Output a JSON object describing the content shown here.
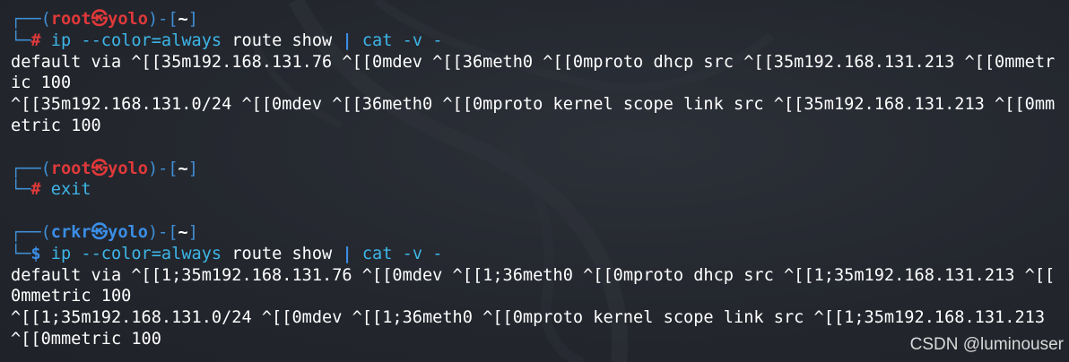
{
  "terminal": {
    "prompt_frame_top": "┌──(",
    "prompt_frame_mid": ")-[",
    "prompt_frame_end": "]",
    "prompt_frame_bottom": "└─",
    "sessions": [
      {
        "user": "root",
        "at": "㉿",
        "host": "yolo",
        "path": "~",
        "symbol": "#",
        "command": "ip",
        "args": " --color=always ",
        "subcmd": "route show",
        "pipe": " | ",
        "cmd2": "cat",
        "cmd2_args": " -v -",
        "output": [
          "default via ^[[35m192.168.131.76 ^[[0mdev ^[[36meth0 ^[[0mproto dhcp src ^[[35m192.168.131.213 ^[[0mmetr",
          "ic 100",
          "^[[35m192.168.131.0/24 ^[[0mdev ^[[36meth0 ^[[0mproto kernel scope link src ^[[35m192.168.131.213 ^[[0mm",
          "etric 100"
        ]
      },
      {
        "user": "root",
        "at": "㉿",
        "host": "yolo",
        "path": "~",
        "symbol": "#",
        "command": "exit"
      },
      {
        "user": "crkr",
        "at": "㉿",
        "host": "yolo",
        "path": "~",
        "symbol": "$",
        "command": "ip",
        "args": " --color=always ",
        "subcmd": "route show",
        "pipe": " | ",
        "cmd2": "cat",
        "cmd2_args": " -v -",
        "output": [
          "default via ^[[1;35m192.168.131.76 ^[[0mdev ^[[1;36meth0 ^[[0mproto dhcp src ^[[1;35m192.168.131.213 ^[[",
          "0mmetric 100",
          "^[[1;35m192.168.131.0/24 ^[[0mdev ^[[1;36meth0 ^[[0mproto kernel scope link src ^[[1;35m192.168.131.213",
          "^[[0mmetric 100"
        ]
      }
    ]
  },
  "watermark": "CSDN @luminouser",
  "colors": {
    "background": "#24282f",
    "frame_blue": "#3f8fd6",
    "root_red": "#e0393a",
    "user_blue": "#3b8ee6",
    "command_cyan": "#3db6e8"
  }
}
